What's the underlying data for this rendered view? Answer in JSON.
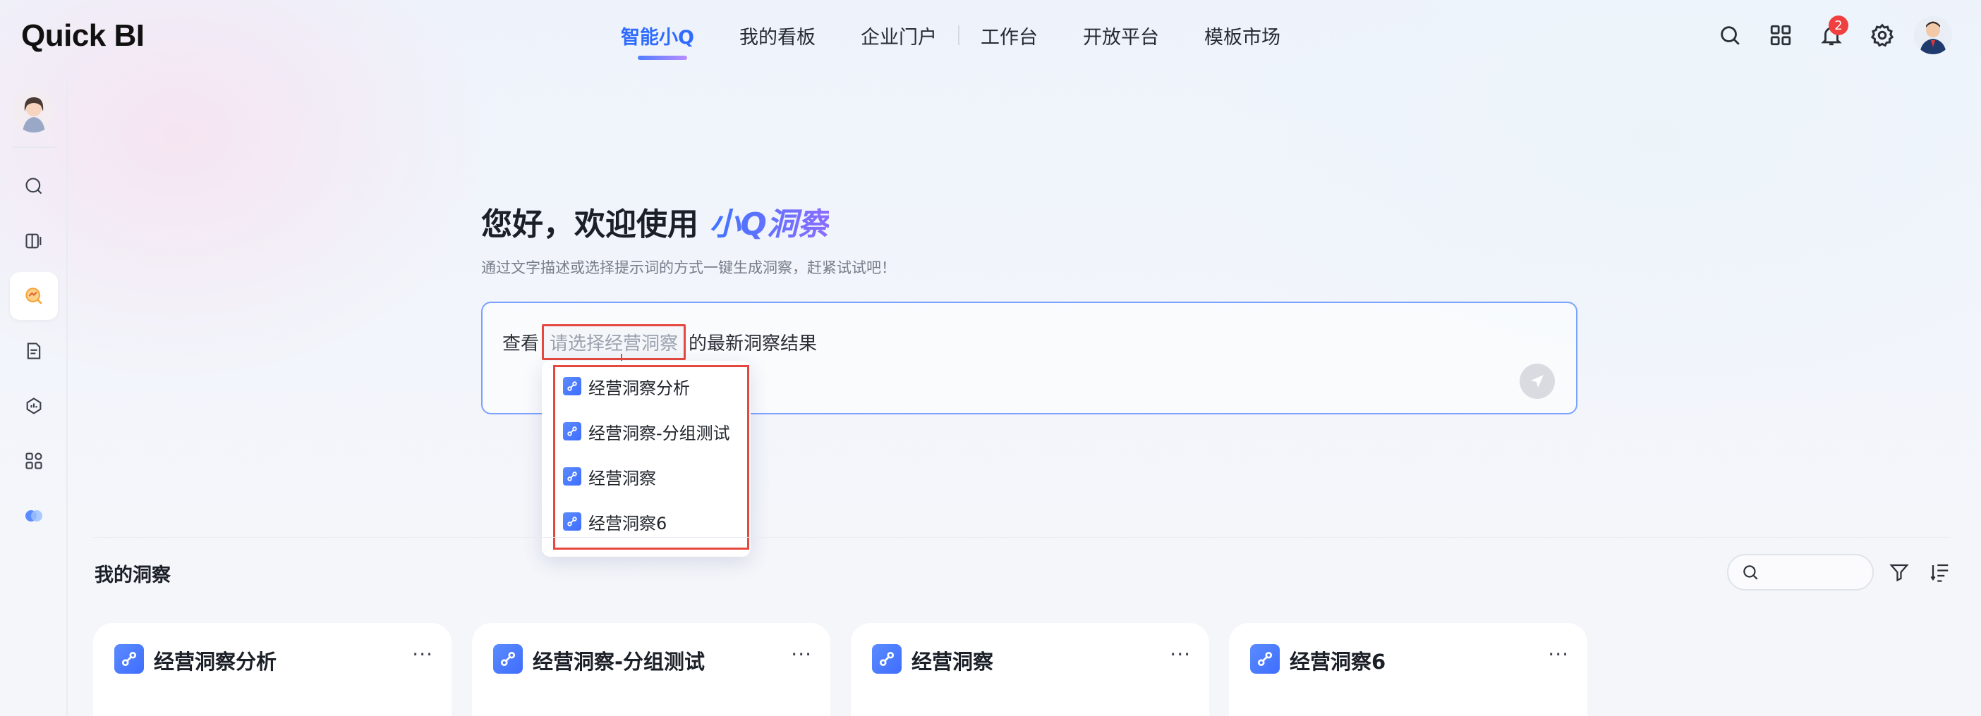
{
  "app": {
    "logo": "Quick BI"
  },
  "nav": {
    "items": [
      {
        "label": "智能小Q",
        "active": true
      },
      {
        "label": "我的看板"
      },
      {
        "label": "企业门户"
      },
      {
        "label": "工作台"
      },
      {
        "label": "开放平台"
      },
      {
        "label": "模板市场"
      }
    ]
  },
  "header": {
    "notifications_count": "2"
  },
  "hero": {
    "greeting": "您好，欢迎使用",
    "brand": "小Q洞察",
    "subtitle": "通过文字描述或选择提示词的方式一键生成洞察，赶紧试试吧！"
  },
  "query": {
    "prefix": "查看",
    "slot_placeholder": "请选择经营洞察",
    "suffix": "的最新洞察结果"
  },
  "dropdown": {
    "options": [
      "经营洞察分析",
      "经营洞察-分组测试",
      "经营洞察",
      "经营洞察6"
    ]
  },
  "section": {
    "title": "我的洞察"
  },
  "cards": [
    {
      "title": "经营洞察分析"
    },
    {
      "title": "经营洞察-分组测试"
    },
    {
      "title": "经营洞察"
    },
    {
      "title": "经营洞察6"
    }
  ],
  "colors": {
    "accent": "#2f6bff",
    "highlight": "#e5483f",
    "badge": "#f03f3f"
  }
}
